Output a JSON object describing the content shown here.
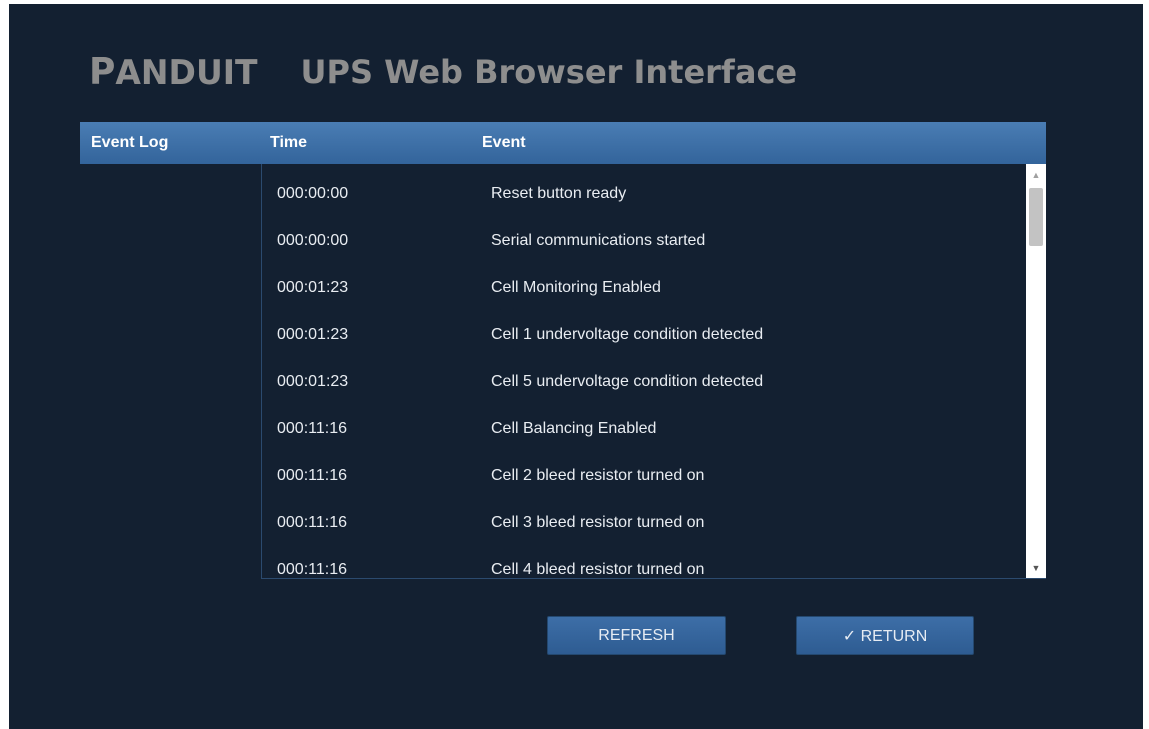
{
  "brand": {
    "logo_first": "P",
    "logo_rest": "ANDUIT",
    "title": "UPS Web Browser Interface"
  },
  "table": {
    "section_label": "Event Log",
    "col_time": "Time",
    "col_event": "Event",
    "rows": [
      {
        "time": "000:00:00",
        "event": "Reset button ready"
      },
      {
        "time": "000:00:00",
        "event": "Serial communications started"
      },
      {
        "time": "000:01:23",
        "event": "Cell Monitoring Enabled"
      },
      {
        "time": "000:01:23",
        "event": "Cell 1 undervoltage condition detected"
      },
      {
        "time": "000:01:23",
        "event": "Cell 5 undervoltage condition detected"
      },
      {
        "time": "000:11:16",
        "event": "Cell Balancing Enabled"
      },
      {
        "time": "000:11:16",
        "event": "Cell 2 bleed resistor turned on"
      },
      {
        "time": "000:11:16",
        "event": "Cell 3 bleed resistor turned on"
      },
      {
        "time": "000:11:16",
        "event": "Cell 4 bleed resistor turned on"
      }
    ]
  },
  "scrollbar": {
    "up_icon": "triangle-up-icon",
    "down_icon": "triangle-down-icon"
  },
  "buttons": {
    "refresh_label": "REFRESH",
    "return_label": "✓ RETURN"
  },
  "colors": {
    "background": "#132031",
    "header_bar": "#3f71aa",
    "button": "#3466a0",
    "logo": "#8d8d8d"
  }
}
